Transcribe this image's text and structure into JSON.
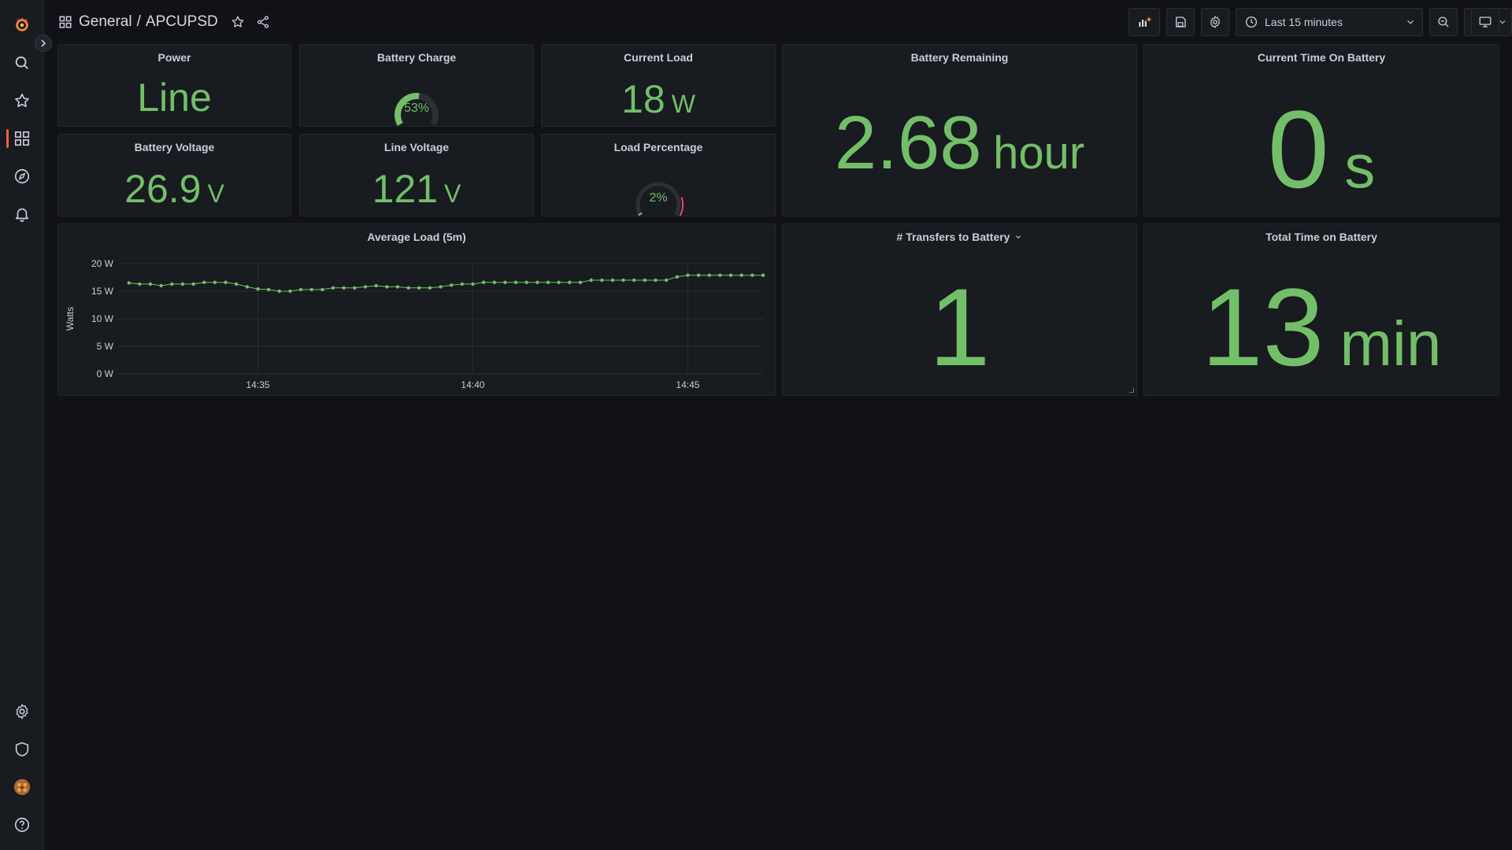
{
  "breadcrumb": {
    "folder": "General",
    "separator": "/",
    "dashboard": "APCUPSD"
  },
  "toolbar": {
    "time_range": "Last 15 minutes"
  },
  "colors": {
    "value": "#73bf69",
    "accent": "#f55f3e",
    "gauge_warn": "#f2495c"
  },
  "panels": {
    "power": {
      "title": "Power",
      "value": "Line"
    },
    "battery_charge": {
      "title": "Battery Charge",
      "value": "53%",
      "fraction": 0.53
    },
    "current_load": {
      "title": "Current Load",
      "value": "18",
      "unit": "W"
    },
    "battery_remaining": {
      "title": "Battery Remaining",
      "value": "2.68",
      "unit": "hour"
    },
    "current_time_on_battery": {
      "title": "Current Time On Battery",
      "value": "0",
      "unit": "s"
    },
    "battery_voltage": {
      "title": "Battery Voltage",
      "value": "26.9",
      "unit": "V"
    },
    "line_voltage": {
      "title": "Line Voltage",
      "value": "121",
      "unit": "V"
    },
    "load_percentage": {
      "title": "Load Percentage",
      "value": "2%",
      "fraction": 0.02
    },
    "average_load": {
      "title": "Average Load (5m)"
    },
    "transfers_to_battery": {
      "title": "# Transfers to Battery",
      "value": "1"
    },
    "total_time_on_battery": {
      "title": "Total Time on Battery",
      "value": "13",
      "unit": "min"
    }
  },
  "sidebar_icons": [
    "grafana-logo-icon",
    "search-icon",
    "star-icon",
    "dashboards-icon",
    "explore-icon",
    "alerting-icon",
    "settings-icon",
    "shield-icon",
    "user-avatar-icon",
    "help-icon"
  ],
  "chart_data": {
    "type": "line",
    "title": "",
    "xlabel": "",
    "ylabel": "Watts",
    "ylim": [
      0,
      20
    ],
    "yticks": [
      "0 W",
      "5 W",
      "10 W",
      "15 W",
      "20 W"
    ],
    "ytick_values": [
      0,
      5,
      10,
      15,
      20
    ],
    "xlim": [
      "14:31:45",
      "14:46:45"
    ],
    "xticks": [
      "14:35",
      "14:40",
      "14:45"
    ],
    "grid": true,
    "series": [
      {
        "x": [
          "14:32:00",
          "14:32:15",
          "14:32:30",
          "14:32:45",
          "14:33:00",
          "14:33:15",
          "14:33:30",
          "14:33:45",
          "14:34:00",
          "14:34:15",
          "14:34:30",
          "14:34:45",
          "14:35:00",
          "14:35:15",
          "14:35:30",
          "14:35:45",
          "14:36:00",
          "14:36:15",
          "14:36:30",
          "14:36:45",
          "14:37:00",
          "14:37:15",
          "14:37:30",
          "14:37:45",
          "14:38:00",
          "14:38:15",
          "14:38:30",
          "14:38:45",
          "14:39:00",
          "14:39:15",
          "14:39:30",
          "14:39:45",
          "14:40:00",
          "14:40:15",
          "14:40:30",
          "14:40:45",
          "14:41:00",
          "14:41:15",
          "14:41:30",
          "14:41:45",
          "14:42:00",
          "14:42:15",
          "14:42:30",
          "14:42:45",
          "14:43:00",
          "14:43:15",
          "14:43:30",
          "14:43:45",
          "14:44:00",
          "14:44:15",
          "14:44:30",
          "14:44:45",
          "14:45:00",
          "14:45:15",
          "14:45:30",
          "14:45:45",
          "14:46:00",
          "14:46:15",
          "14:46:30",
          "14:46:45"
        ],
        "values": [
          16.5,
          16.3,
          16.3,
          16.0,
          16.3,
          16.3,
          16.3,
          16.6,
          16.6,
          16.6,
          16.3,
          15.8,
          15.4,
          15.3,
          15.0,
          15.0,
          15.3,
          15.3,
          15.3,
          15.6,
          15.6,
          15.6,
          15.8,
          16.0,
          15.8,
          15.8,
          15.6,
          15.6,
          15.6,
          15.8,
          16.1,
          16.3,
          16.3,
          16.6,
          16.6,
          16.6,
          16.6,
          16.6,
          16.6,
          16.6,
          16.6,
          16.6,
          16.6,
          17.0,
          17.0,
          17.0,
          17.0,
          17.0,
          17.0,
          17.0,
          17.0,
          17.6,
          17.9,
          17.9,
          17.9,
          17.9,
          17.9,
          17.9,
          17.9,
          17.9
        ]
      }
    ]
  }
}
